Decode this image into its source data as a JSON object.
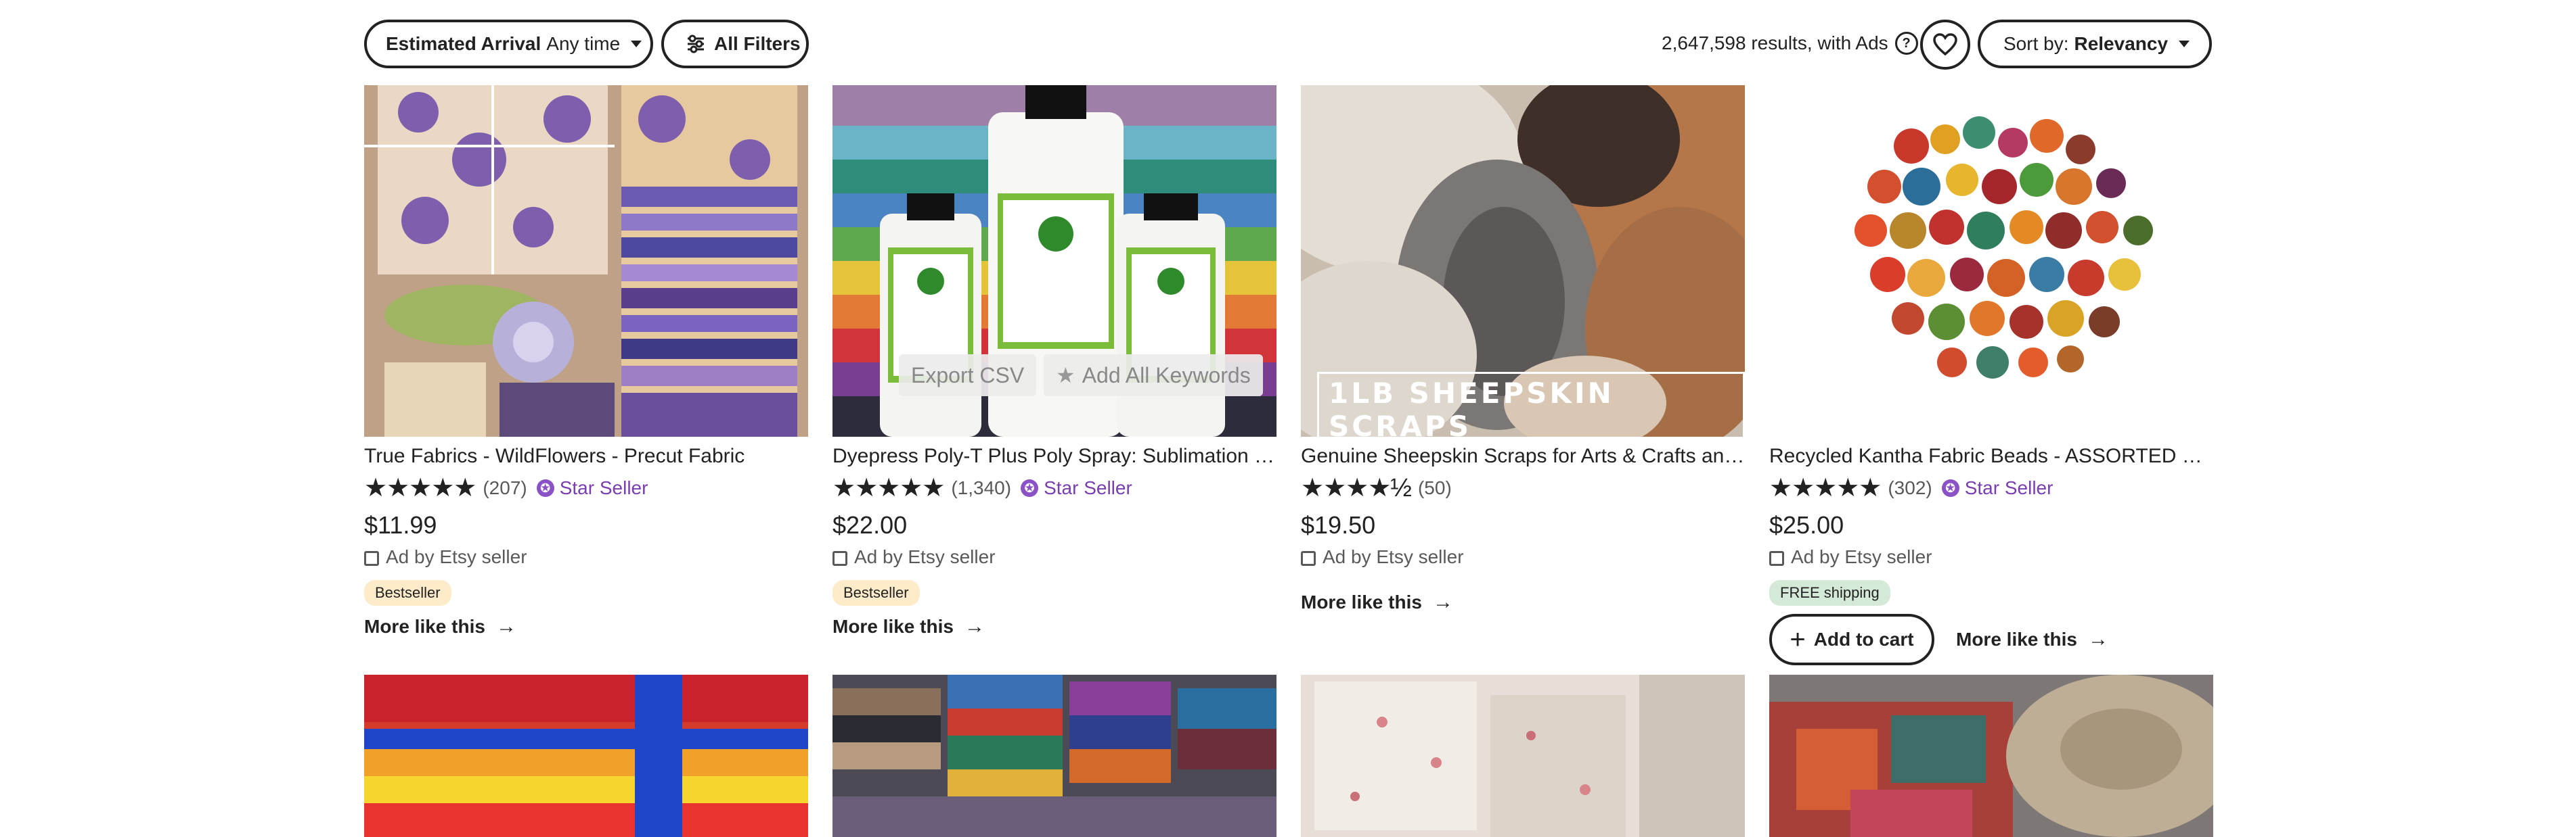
{
  "toolbar": {
    "arrival_label": "Estimated Arrival",
    "arrival_value": "Any time",
    "filters_label": "All Filters",
    "results_text": "2,647,598 results, with Ads",
    "help_glyph": "?",
    "sort_label": "Sort by:",
    "sort_value": "Relevancy"
  },
  "overlay": {
    "export_csv": "Export CSV",
    "add_keywords": "Add All Keywords"
  },
  "listings": [
    {
      "title": "True Fabrics - WildFlowers - Precut Fabric",
      "stars": "★★★★★",
      "reviews": "(207)",
      "star_seller": "Star Seller",
      "price": "$11.99",
      "ad_text": "Ad by Etsy seller",
      "badge": "Bestseller",
      "more": "More like this"
    },
    {
      "title": "Dyepress Poly-T Plus Poly Spray: Sublimation Coating for Cotton",
      "stars": "★★★★★",
      "reviews": "(1,340)",
      "star_seller": "Star Seller",
      "price": "$22.00",
      "ad_text": "Ad by Etsy seller",
      "badge": "Bestseller",
      "more": "More like this"
    },
    {
      "title": "Genuine Sheepskin Scraps for Arts & Crafts and More",
      "stars": "★★★★½",
      "reviews": "(50)",
      "price": "$19.50",
      "ad_text": "Ad by Etsy seller",
      "more": "More like this",
      "image_text": "1LB SHEEPSKIN SCRAPS"
    },
    {
      "title": "Recycled Kantha Fabric Beads - ASSORTED Sizes",
      "stars": "★★★★★",
      "reviews": "(302)",
      "star_seller": "Star Seller",
      "price": "$25.00",
      "ad_text": "Ad by Etsy seller",
      "badge": "FREE shipping",
      "add_to_cart": "Add to cart",
      "more": "More like this"
    }
  ],
  "colors": {
    "star_seller": "#7a3eb1",
    "bestseller_bg": "#fdebc9",
    "free_shipping_bg": "#d4e9d7"
  },
  "icons": [
    "chevron-down-icon",
    "filter-sliders-icon",
    "help-circle-icon",
    "heart-icon",
    "star-seller-icon",
    "lock-icon",
    "arrow-right-icon",
    "plus-icon",
    "star-icon"
  ]
}
